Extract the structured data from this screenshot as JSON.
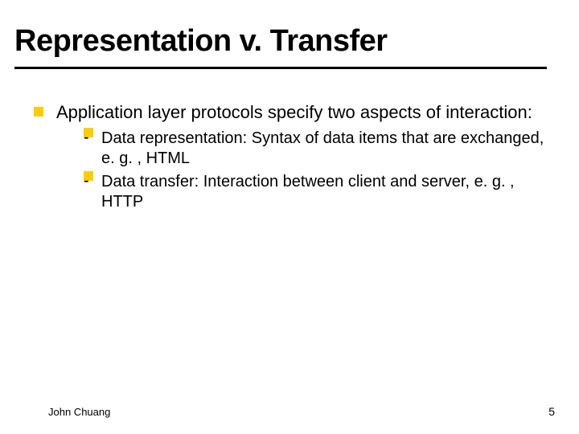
{
  "title": "Representation v. Transfer",
  "bullets": [
    {
      "text": "Application layer protocols specify two aspects of interaction:",
      "sub": [
        "Data representation: Syntax of data items that are exchanged, e. g. , HTML",
        "Data transfer: Interaction between client and server, e. g. , HTTP"
      ]
    }
  ],
  "footer": "John Chuang",
  "page_number": "5"
}
